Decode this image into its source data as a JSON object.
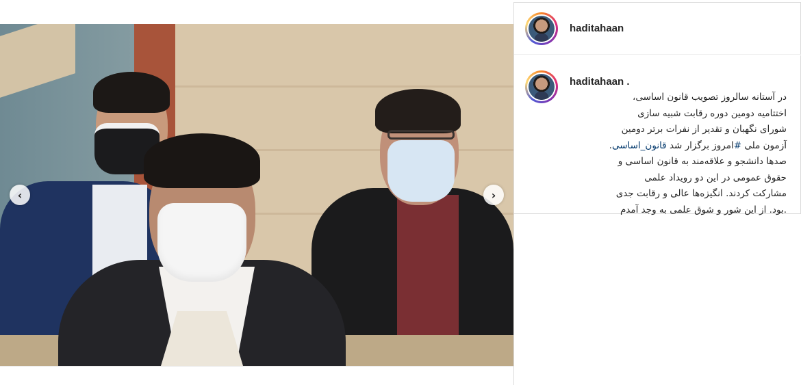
{
  "post": {
    "username": "haditahaan",
    "comment_username": "haditahaan .",
    "caption_lines": [
      "در آستانه سالروز تصویب قانون اساسی،",
      "اختتامیه دومین دوره رقابت شبیه سازی",
      "شورای نگهبان و تقدیر از نفرات برتر دومین"
    ],
    "caption_line4_text_a": ".",
    "caption_line4_hashtag": "قانون_اساسی",
    "caption_line4_text_b": "امروز برگزار شد",
    "caption_line4_hashsign": "#",
    "caption_line4_text_c": "آزمون ملی",
    "caption_lines_rest": [
      "صدها دانشجو و علاقه‌مند به قانون اساسی و",
      "حقوق عمومی در این دو رویداد علمی",
      "مشارکت کردند. انگیزه‌ها عالی و رقابت جدی",
      ".بود. از این شور و شوق علمی به وجد آمدم"
    ]
  },
  "carousel": {
    "prev_icon": "chevron-left-icon",
    "next_icon": "chevron-right-icon",
    "prev_glyph": "‹",
    "next_glyph": "›",
    "slide_count": 8,
    "active_slide": 3
  },
  "colors": {
    "text": "#262626",
    "hashtag": "#00376b",
    "border": "#dbdbdb"
  }
}
